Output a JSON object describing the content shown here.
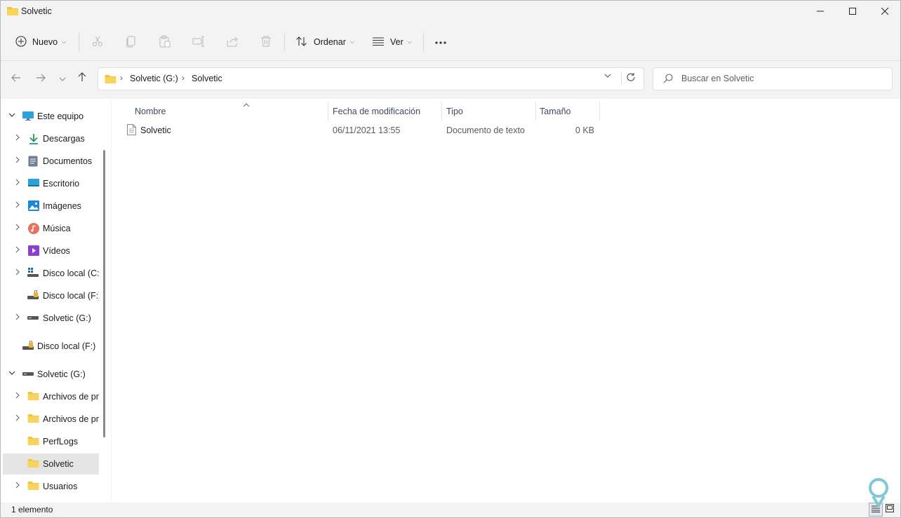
{
  "window": {
    "title": "Solvetic"
  },
  "toolbar": {
    "new_label": "Nuevo",
    "sort_label": "Ordenar",
    "view_label": "Ver",
    "more_label": "···"
  },
  "address": {
    "crumbs": [
      "Solvetic (G:)",
      "Solvetic"
    ]
  },
  "search": {
    "placeholder": "Buscar en Solvetic"
  },
  "nav": {
    "items": [
      {
        "label": "Este equipo",
        "icon": "monitor-icon"
      },
      {
        "label": "Descargas",
        "icon": "download-icon"
      },
      {
        "label": "Documentos",
        "icon": "document-icon"
      },
      {
        "label": "Escritorio",
        "icon": "desktop-icon"
      },
      {
        "label": "Imágenes",
        "icon": "pictures-icon"
      },
      {
        "label": "Música",
        "icon": "music-icon"
      },
      {
        "label": "Vídeos",
        "icon": "videos-icon"
      },
      {
        "label": "Disco local (C:",
        "icon": "windows-drive-icon"
      },
      {
        "label": "Disco local (F:)",
        "icon": "locked-drive-icon"
      },
      {
        "label": "Solvetic (G:)",
        "icon": "drive-icon"
      },
      {
        "label": "Disco local (F:)",
        "icon": "locked-drive-icon"
      },
      {
        "label": "Solvetic (G:)",
        "icon": "drive-icon"
      },
      {
        "label": "Archivos de pro",
        "icon": "folder-icon"
      },
      {
        "label": "Archivos de pro",
        "icon": "folder-icon"
      },
      {
        "label": "PerfLogs",
        "icon": "folder-icon"
      },
      {
        "label": "Solvetic",
        "icon": "folder-icon"
      },
      {
        "label": "Usuarios",
        "icon": "folder-icon"
      }
    ]
  },
  "columns": {
    "name": "Nombre",
    "modified": "Fecha de modificación",
    "type": "Tipo",
    "size": "Tamaño"
  },
  "files": [
    {
      "name": "Solvetic",
      "modified": "06/11/2021 13:55",
      "type": "Documento de texto",
      "size": "0 KB"
    }
  ],
  "status": {
    "count": "1 elemento"
  },
  "colors": {
    "folder": "#f3c338",
    "accent": "#0067c0",
    "selected": "#e5e5e5"
  }
}
